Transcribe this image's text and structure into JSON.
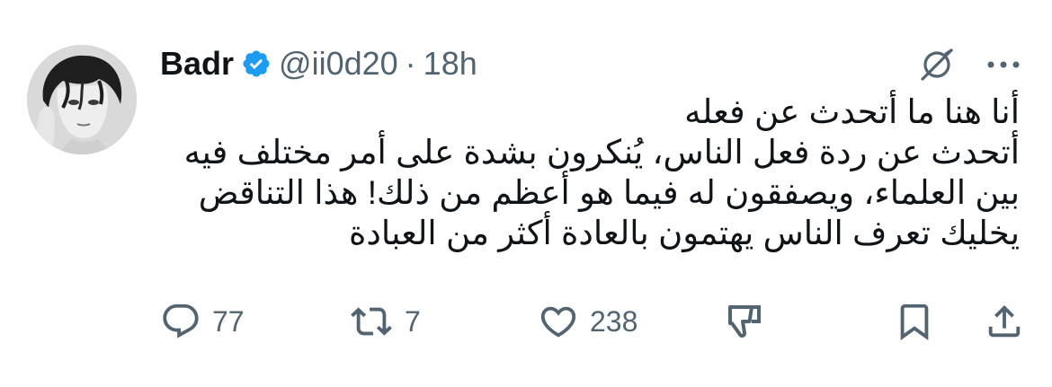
{
  "author": {
    "name": "Badr",
    "handle": "@ii0d20",
    "separator": "·",
    "time": "18h",
    "verified_color": "#1d9bf0"
  },
  "tweet": {
    "lines": [
      "أنا هنا ما أتحدث عن فعله",
      "أتحدث عن ردة فعل الناس، يُنكرون بشدة على أمر مختلف فيه بين العلماء، ويصفقون له فيما هو أعظم من ذلك! هذا التناقض يخليك تعرف الناس يهتمون بالعادة أكثر من العبادة"
    ]
  },
  "actions": {
    "replies": "77",
    "retweets": "7",
    "likes": "238"
  },
  "icons": {
    "top": [
      "grok-icon",
      "more-icon"
    ],
    "bar": [
      "reply-icon",
      "retweet-icon",
      "like-icon",
      "dislike-icon",
      "bookmark-icon",
      "share-icon"
    ]
  },
  "colors": {
    "text": "#0f1419",
    "secondary": "#536471",
    "verified": "#1d9bf0"
  }
}
